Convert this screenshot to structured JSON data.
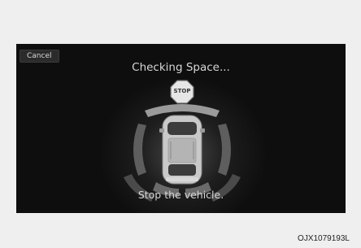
{
  "screen": {
    "cancel_label": "Cancel",
    "title": "Checking Space...",
    "stop_sign_text": "STOP",
    "message": "Stop the vehicle."
  },
  "caption": "OJX1079193L"
}
